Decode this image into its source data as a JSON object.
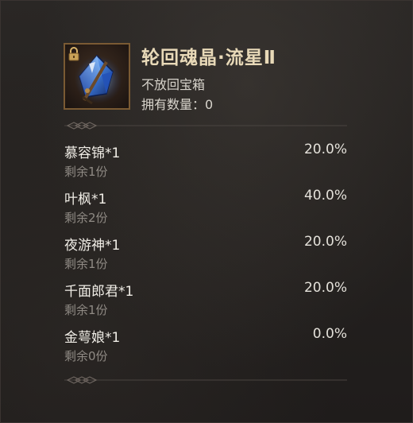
{
  "item": {
    "icon": "blue-crystal-icon",
    "locked": true,
    "title": "轮回魂晶·流星Ⅱ",
    "subtitle": "不放回宝箱",
    "count_label": "拥有数量：0"
  },
  "rewards": [
    {
      "name": "慕容锦*1",
      "remaining": "剩余1份",
      "rate": "20.0%"
    },
    {
      "name": "叶枫*1",
      "remaining": "剩余2份",
      "rate": "40.0%"
    },
    {
      "name": "夜游神*1",
      "remaining": "剩余1份",
      "rate": "20.0%"
    },
    {
      "name": "千面郎君*1",
      "remaining": "剩余1份",
      "rate": "20.0%"
    },
    {
      "name": "金萼娘*1",
      "remaining": "剩余0份",
      "rate": "0.0%"
    }
  ],
  "colors": {
    "title": "#e8d9b8",
    "text": "#f0ede6",
    "muted": "#8f8a84",
    "frame": "#7a5a33"
  }
}
